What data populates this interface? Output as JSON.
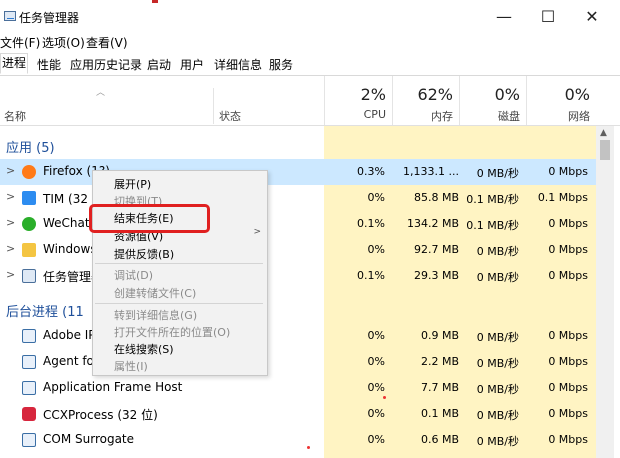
{
  "window": {
    "title": "任务管理器",
    "minimize": "—",
    "maximize": "☐",
    "close": "✕"
  },
  "menu": [
    "文件(F)",
    "选项(O)",
    "查看(V)"
  ],
  "tabs": [
    "进程",
    "性能",
    "应用历史记录",
    "启动",
    "用户",
    "详细信息",
    "服务"
  ],
  "header": {
    "name": "名称",
    "status": "状态",
    "columns": [
      {
        "pct": "2%",
        "label": "CPU"
      },
      {
        "pct": "62%",
        "label": "内存"
      },
      {
        "pct": "0%",
        "label": "磁盘"
      },
      {
        "pct": "0%",
        "label": "网络"
      }
    ]
  },
  "groups": {
    "apps": "应用 (5)",
    "background": "后台进程 (11"
  },
  "apps": [
    {
      "name": "Firefox (1?)",
      "cpu": "0.3%",
      "mem": "1,133.1 ...",
      "disk": "0 MB/秒",
      "net": "0 Mbps",
      "icon": "firefox-icon"
    },
    {
      "name": "TIM (32 位",
      "cpu": "0%",
      "mem": "85.8 MB",
      "disk": "0.1 MB/秒",
      "net": "0.1 Mbps",
      "icon": "tim-icon"
    },
    {
      "name": "WeChat",
      "cpu": "0.1%",
      "mem": "134.2 MB",
      "disk": "0.1 MB/秒",
      "net": "0 Mbps",
      "icon": "wechat-icon"
    },
    {
      "name": "Windows",
      "cpu": "0%",
      "mem": "92.7 MB",
      "disk": "0 MB/秒",
      "net": "0 Mbps",
      "icon": "folder-icon"
    },
    {
      "name": "任务管理器",
      "cpu": "0.1%",
      "mem": "29.3 MB",
      "disk": "0 MB/秒",
      "net": "0 Mbps",
      "icon": "taskmanager-icon"
    }
  ],
  "background": [
    {
      "name": "Adobe IP",
      "cpu": "0%",
      "mem": "0.9 MB",
      "disk": "0 MB/秒",
      "net": "0 Mbps",
      "icon": "app-window-icon"
    },
    {
      "name": "Agent fo",
      "cpu": "0%",
      "mem": "2.2 MB",
      "disk": "0 MB/秒",
      "net": "0 Mbps",
      "icon": "app-window-icon"
    },
    {
      "name": "Application Frame Host",
      "cpu": "0%",
      "mem": "7.7 MB",
      "disk": "0 MB/秒",
      "net": "0 Mbps",
      "icon": "app-window-icon"
    },
    {
      "name": "CCXProcess (32 位)",
      "cpu": "0%",
      "mem": "0.1 MB",
      "disk": "0 MB/秒",
      "net": "0 Mbps",
      "icon": "ccx-icon"
    },
    {
      "name": "COM Surrogate",
      "cpu": "0%",
      "mem": "0.6 MB",
      "disk": "0 MB/秒",
      "net": "0 Mbps",
      "icon": "app-window-icon"
    }
  ],
  "context_menu": [
    {
      "label": "展开(P)",
      "disabled": false
    },
    {
      "label": "切换到(T)",
      "disabled": true
    },
    {
      "label": "结束任务(E)",
      "disabled": false
    },
    {
      "label": "资源值(V)",
      "disabled": false
    },
    {
      "label": "提供反馈(B)",
      "disabled": false
    },
    {
      "label": "调试(D)",
      "disabled": true
    },
    {
      "label": "创建转储文件(C)",
      "disabled": true
    },
    {
      "label": "转到详细信息(G)",
      "disabled": true
    },
    {
      "label": "打开文件所在的位置(O)",
      "disabled": true
    },
    {
      "label": "在线搜索(S)",
      "disabled": false
    },
    {
      "label": "属性(I)",
      "disabled": true
    }
  ],
  "colors": {
    "selected_row": "#cce8ff",
    "heat": "#fff4c3",
    "group_text": "#1e4f9a",
    "highlight_box": "#e02020"
  }
}
